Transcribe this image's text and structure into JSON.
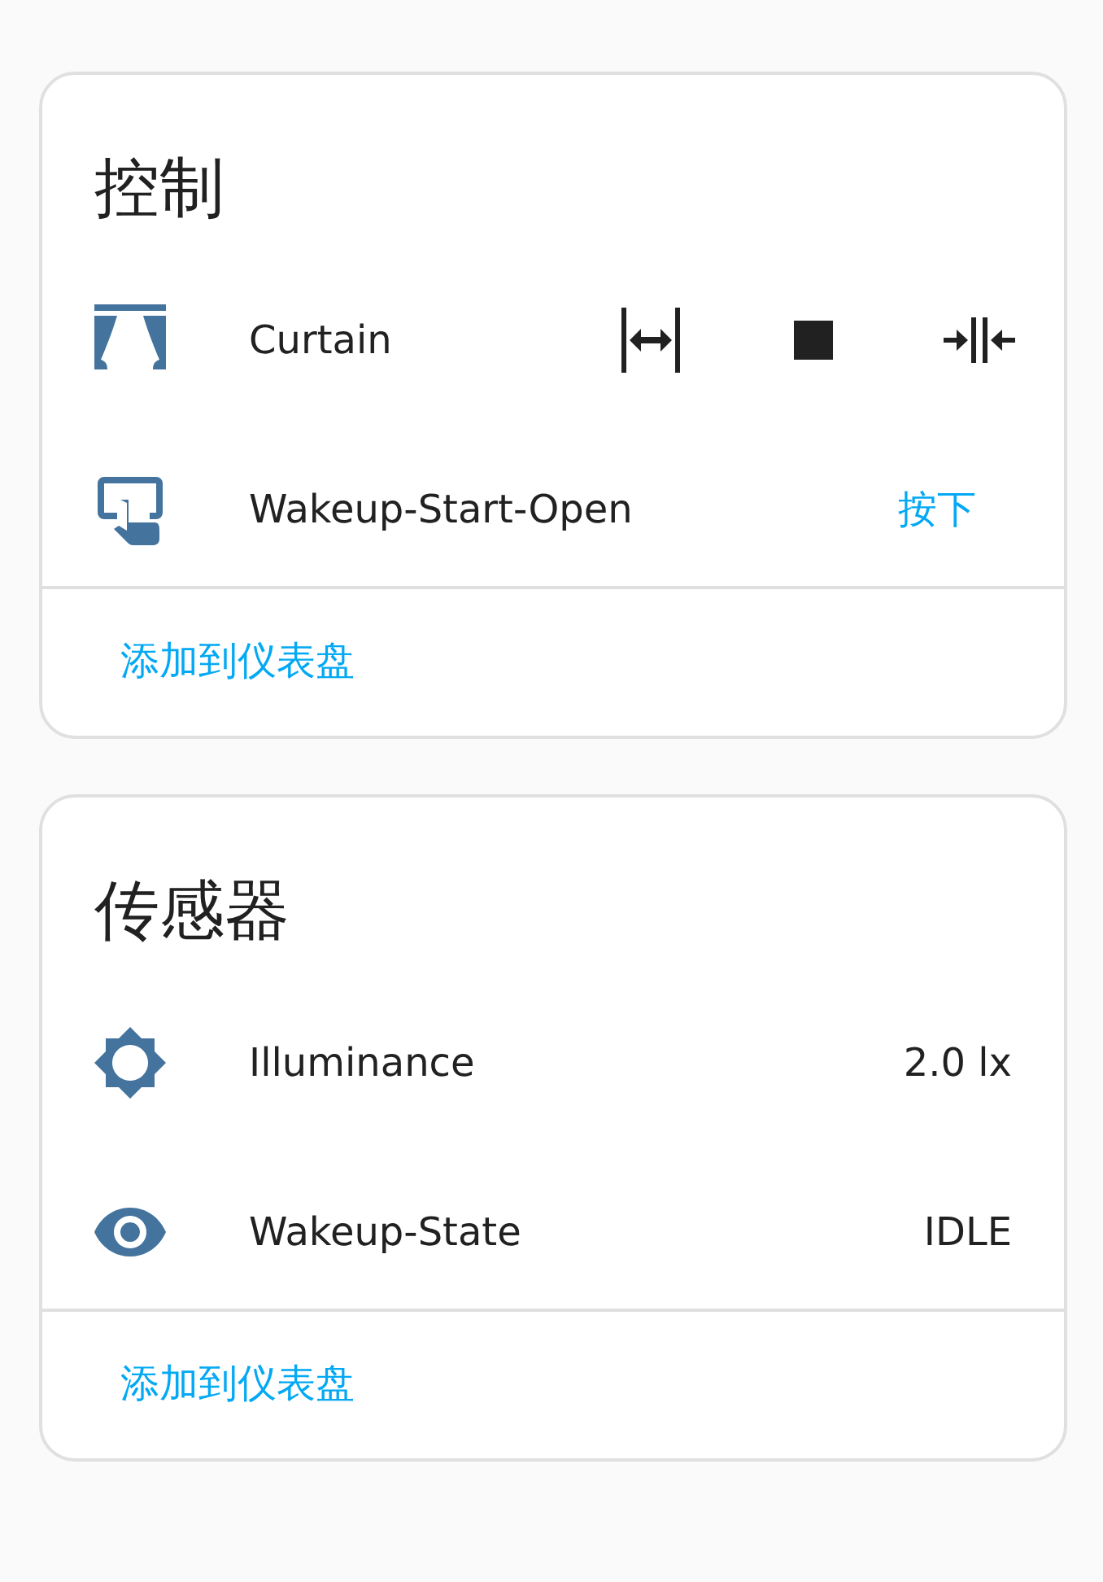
{
  "cards": [
    {
      "title": "控制",
      "rows": [
        {
          "kind": "cover",
          "name": "Curtain"
        },
        {
          "kind": "button",
          "name": "Wakeup-Start-Open",
          "action": "按下"
        }
      ],
      "footer_link": "添加到仪表盘"
    },
    {
      "title": "传感器",
      "rows": [
        {
          "kind": "illuminance-sensor",
          "name": "Illuminance",
          "value": "2.0 lx"
        },
        {
          "kind": "state-sensor",
          "name": "Wakeup-State",
          "value": "IDLE"
        }
      ],
      "footer_link": "添加到仪表盘"
    }
  ]
}
